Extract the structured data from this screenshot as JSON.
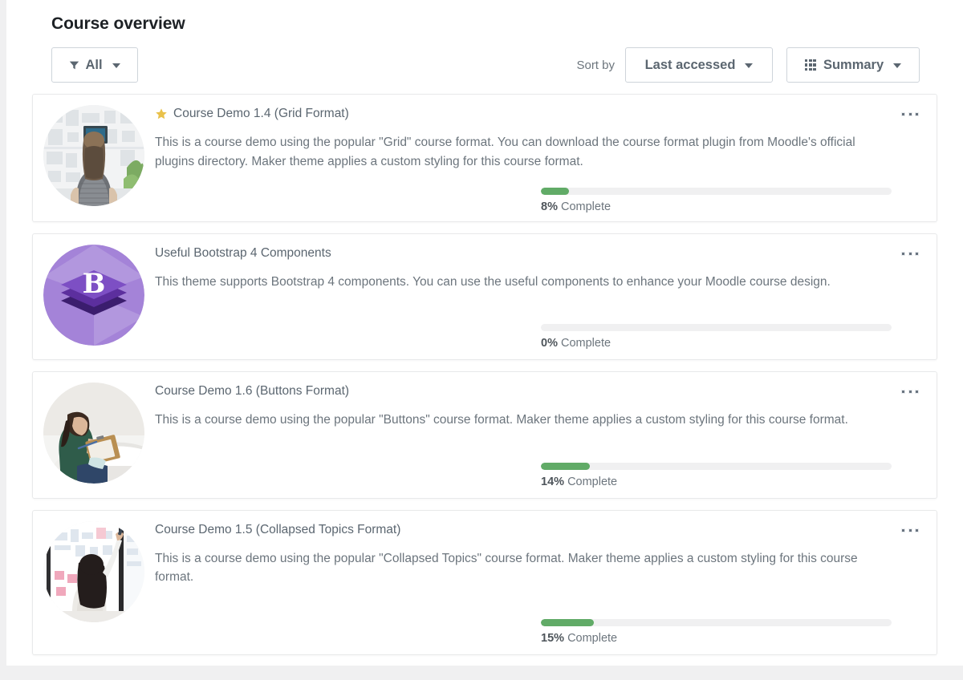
{
  "header": {
    "title": "Course overview"
  },
  "controls": {
    "filter_label": "All",
    "filter_icon": "funnel-icon",
    "sort_prefix": "Sort by",
    "sort_value": "Last accessed",
    "view_value": "Summary",
    "view_icon": "grid-icon",
    "caret_icon": "chevron-down-icon"
  },
  "colors": {
    "progress_fill": "#61ab67",
    "progress_track": "#f0f0f1",
    "star": "#e9c14a",
    "title_text": "#1d2125",
    "body_text": "#6c757d",
    "border": "#e8e9ea",
    "bootstrap_purple": "#7952b3"
  },
  "courses": [
    {
      "title": "Course Demo 1.4 (Grid Format)",
      "starred": true,
      "summary": "This is a course demo using the popular \"Grid\" course format. You can download the course format plugin from Moodle's official plugins directory. Maker theme applies a custom styling for this course format.",
      "progress_percent": 8,
      "progress_value": "8%",
      "progress_suffix": "Complete",
      "thumbnail": "photo-person-at-inspiration-wall",
      "menu_icon": "ellipsis-icon"
    },
    {
      "title": "Useful Bootstrap 4 Components",
      "starred": false,
      "summary": "This theme supports Bootstrap 4 components. You can use the useful components to enhance your Moodle course design.",
      "progress_percent": 0,
      "progress_value": "0%",
      "progress_suffix": "Complete",
      "thumbnail": "bootstrap-logo",
      "menu_icon": "ellipsis-icon"
    },
    {
      "title": "Course Demo 1.6 (Buttons Format)",
      "starred": false,
      "summary": "This is a course demo using the popular \"Buttons\" course format. Maker theme applies a custom styling for this course format.",
      "progress_percent": 14,
      "progress_value": "14%",
      "progress_suffix": "Complete",
      "thumbnail": "photo-woman-with-clipboard",
      "menu_icon": "ellipsis-icon"
    },
    {
      "title": "Course Demo 1.5 (Collapsed Topics Format)",
      "starred": false,
      "summary": "This is a course demo using the popular \"Collapsed Topics\" course format. Maker theme applies a custom styling for this course format.",
      "progress_percent": 15,
      "progress_value": "15%",
      "progress_suffix": "Complete",
      "thumbnail": "photo-woman-at-whiteboard",
      "menu_icon": "ellipsis-icon"
    }
  ]
}
